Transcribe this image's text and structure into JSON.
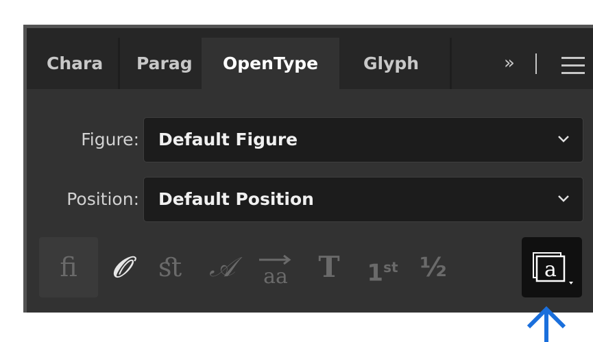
{
  "tabs": [
    {
      "label": "Chara",
      "active": false
    },
    {
      "label": "Parag",
      "active": false
    },
    {
      "label": "OpenType",
      "active": true
    },
    {
      "label": "Glyph",
      "active": false
    }
  ],
  "overflow_label": "»",
  "figure": {
    "label": "Figure:",
    "value": "Default Figure"
  },
  "position": {
    "label": "Position:",
    "value": "Default Position"
  },
  "feature_icons": [
    {
      "name": "standard-ligatures-icon",
      "glyph": "ﬁ"
    },
    {
      "name": "contextual-alternates-icon",
      "glyph": "𝒪"
    },
    {
      "name": "discretionary-ligatures-icon",
      "glyph": "ﬆ"
    },
    {
      "name": "swash-icon",
      "glyph": "𝒜"
    },
    {
      "name": "stylistic-alternates-icon",
      "glyph": "aa"
    },
    {
      "name": "titling-alternates-icon",
      "glyph": "T"
    },
    {
      "name": "ordinals-icon",
      "glyph": "1st"
    },
    {
      "name": "fractions-icon",
      "glyph": "½"
    },
    {
      "name": "stylistic-sets-icon",
      "glyph": "a"
    }
  ],
  "colors": {
    "accent_arrow": "#1a6fdc",
    "panel": "#323232",
    "tabbar": "#262626"
  }
}
